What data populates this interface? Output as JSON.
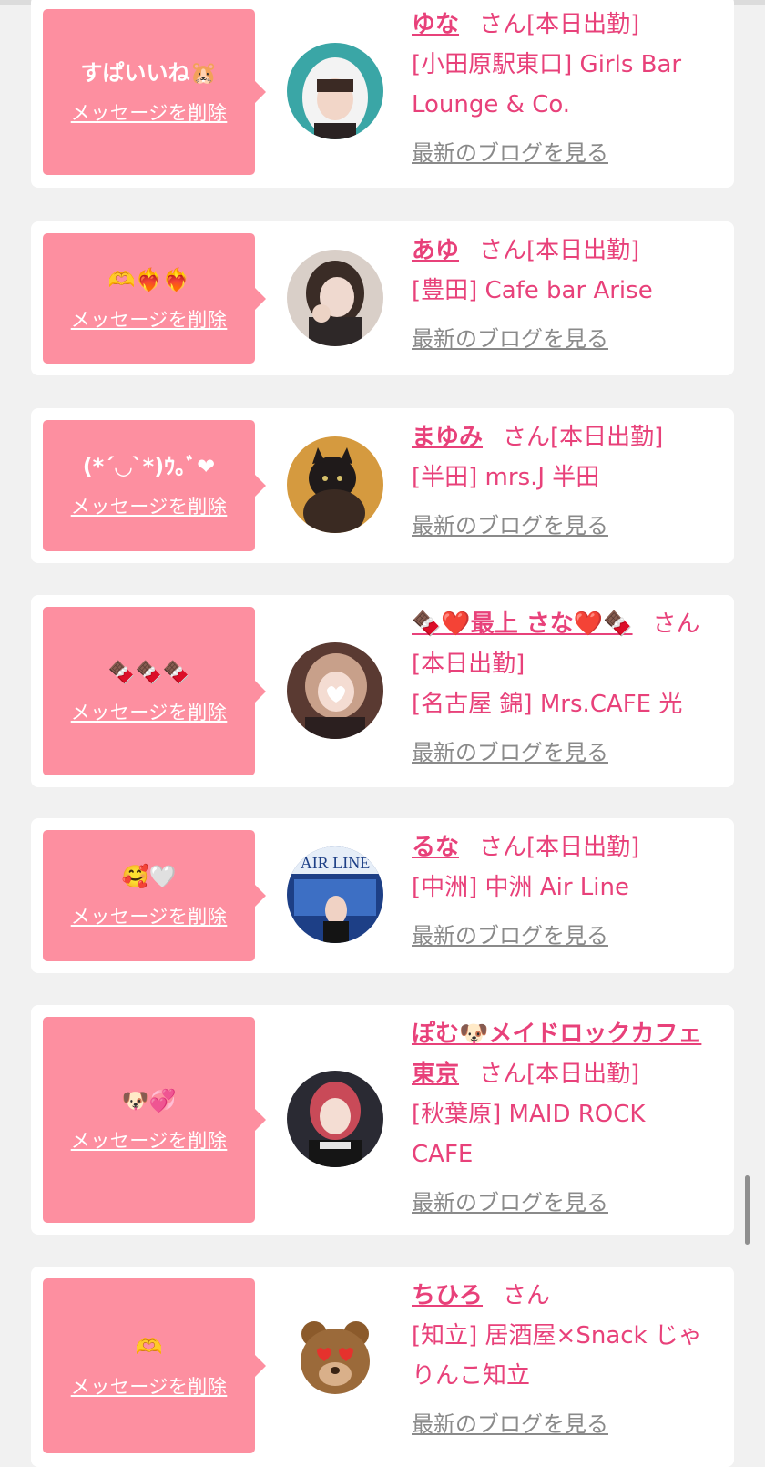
{
  "items": [
    {
      "message": "すぱいいね🐹",
      "delete_label": "メッセージを削除",
      "name": "ゆな",
      "honorific": "さん",
      "status": "[本日出勤]",
      "shop": "[小田原駅東口] Girls Bar Lounge & Co.",
      "blog_label": "最新のブログを見る"
    },
    {
      "message": "🫶❤️‍🔥❤️‍🔥",
      "delete_label": "メッセージを削除",
      "name": "あゆ",
      "honorific": "さん",
      "status": "[本日出勤]",
      "shop": "[豊田] Cafe bar Arise",
      "blog_label": "最新のブログを見る"
    },
    {
      "message": "(*´◡`*)ｳ｡ﾞ❤",
      "delete_label": "メッセージを削除",
      "name": "まゆみ",
      "honorific": "さん",
      "status": "[本日出勤]",
      "shop": "[半田] mrs.J 半田",
      "blog_label": "最新のブログを見る"
    },
    {
      "message": "🍫🍫🍫",
      "delete_label": "メッセージを削除",
      "name": "🍫❤️最上 さな❤️🍫",
      "honorific": "さん",
      "status": "[本日出勤]",
      "shop": "[名古屋 錦] Mrs.CAFE 光",
      "blog_label": "最新のブログを見る"
    },
    {
      "message": "🥰🤍",
      "delete_label": "メッセージを削除",
      "name": "るな",
      "honorific": "さん",
      "status": "[本日出勤]",
      "shop": "[中洲] 中洲 Air Line",
      "blog_label": "最新のブログを見る",
      "avatar_text": "AIR LINE"
    },
    {
      "message": "🐶💞",
      "delete_label": "メッセージを削除",
      "name": "ぽむ🐶メイドロックカフェ東京",
      "honorific": "さん",
      "status": "[本日出勤]",
      "shop": "[秋葉原] MAID ROCK CAFE",
      "blog_label": "最新のブログを見る"
    },
    {
      "message": "🫶",
      "delete_label": "メッセージを削除",
      "name": "ちひろ",
      "honorific": "さん",
      "status": "",
      "shop": "[知立] 居酒屋×Snack じゃりんこ知立",
      "blog_label": "最新のブログを見る"
    }
  ],
  "colors": {
    "background": "#f1f1f1",
    "card": "#ffffff",
    "bubble": "#fd8fa0",
    "accent_text": "#e8417a",
    "link_gray": "#8a8a8a"
  }
}
